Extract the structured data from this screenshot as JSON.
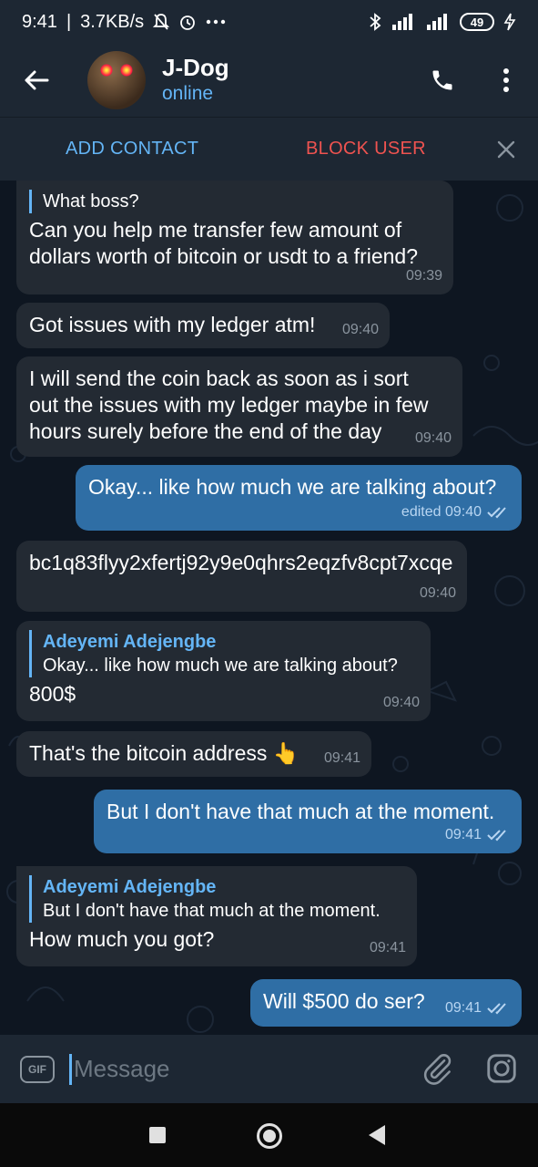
{
  "status_bar": {
    "time": "9:41",
    "speed": "3.7KB/s",
    "battery": "49"
  },
  "header": {
    "name": "J-Dog",
    "status": "online"
  },
  "actions": {
    "add_contact": "ADD CONTACT",
    "block_user": "BLOCK USER"
  },
  "messages": [
    {
      "dir": "in",
      "reply_text": "What boss?",
      "text": "Can you help me transfer few amount of dollars worth of bitcoin or usdt to a friend?",
      "time": "09:39"
    },
    {
      "dir": "in",
      "text": "Got issues with my ledger atm!",
      "time": "09:40"
    },
    {
      "dir": "in",
      "text": "I will send the coin back as soon as i sort out the issues with my ledger maybe in few hours surely before the end of the day",
      "time": "09:40"
    },
    {
      "dir": "out",
      "text": "Okay... like how much we are talking about?",
      "time": "edited 09:40"
    },
    {
      "dir": "in",
      "text": "bc1q83flyy2xfertj92y9e0qhrs2eqzfv8cpt7xcqe",
      "time": "09:40"
    },
    {
      "dir": "in",
      "reply_name": "Adeyemi Adejengbe",
      "reply_text": "Okay... like how much we are talking about?",
      "text": "800$",
      "time": "09:40"
    },
    {
      "dir": "in",
      "text": "That's the bitcoin address 👆",
      "time": "09:41"
    },
    {
      "dir": "out",
      "text": "But I don't have that much at the moment.",
      "time": "09:41"
    },
    {
      "dir": "in",
      "reply_name": "Adeyemi Adejengbe",
      "reply_text": "But I don't have that much at the moment.",
      "text": "How much you got?",
      "time": "09:41"
    },
    {
      "dir": "out",
      "text": "Will $500 do ser?",
      "time": "09:41"
    }
  ],
  "input": {
    "gif_label": "GIF",
    "placeholder": "Message"
  },
  "colors": {
    "accent": "#64b5f6",
    "danger": "#ef5350",
    "outgoing_bubble": "#2f6ea5",
    "incoming_bubble": "#232a33"
  }
}
